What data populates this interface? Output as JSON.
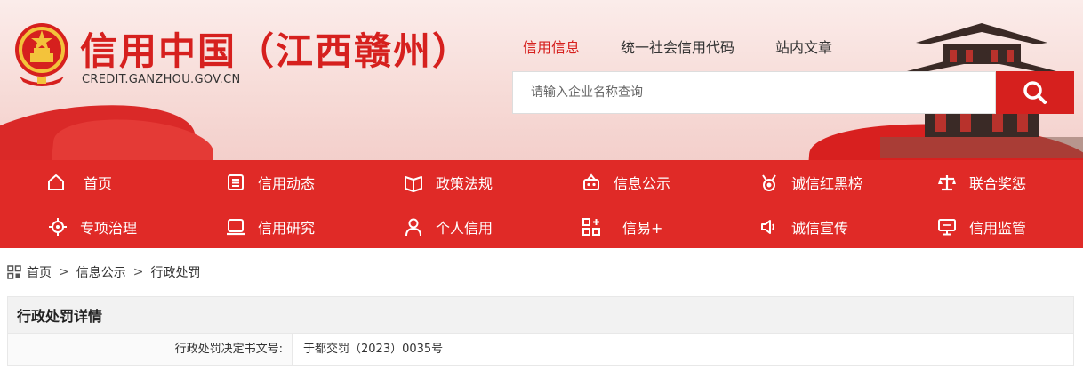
{
  "header": {
    "title": "信用中国（江西赣州）",
    "url": "CREDIT.GANZHOU.GOV.CN",
    "top_links": [
      {
        "label": "信用信息",
        "active": true
      },
      {
        "label": "统一社会信用代码",
        "active": false
      },
      {
        "label": "站内文章",
        "active": false
      }
    ],
    "search": {
      "placeholder": "请输入企业名称查询",
      "value": ""
    },
    "accent_color": "#d6201e"
  },
  "nav": {
    "items": [
      {
        "label": "首页",
        "icon": "home-icon"
      },
      {
        "label": "信用动态",
        "icon": "list-icon"
      },
      {
        "label": "政策法规",
        "icon": "book-icon"
      },
      {
        "label": "信息公示",
        "icon": "announce-icon"
      },
      {
        "label": "诚信红黑榜",
        "icon": "medal-icon"
      },
      {
        "label": "联合奖惩",
        "icon": "scale-icon"
      },
      {
        "label": "专项治理",
        "icon": "target-icon"
      },
      {
        "label": "信用研究",
        "icon": "laptop-icon"
      },
      {
        "label": "个人信用",
        "icon": "person-icon"
      },
      {
        "label": "信易+",
        "icon": "grid-plus-icon"
      },
      {
        "label": "诚信宣传",
        "icon": "speaker-icon"
      },
      {
        "label": "信用监管",
        "icon": "monitor-icon"
      }
    ],
    "bg_color": "#e02a27"
  },
  "breadcrumb": {
    "items": [
      "首页",
      "信息公示",
      "行政处罚"
    ],
    "separator": ">"
  },
  "detail": {
    "heading": "行政处罚详情",
    "rows": [
      {
        "key": "行政处罚决定书文号:",
        "value": "于都交罚（2023）0035号"
      }
    ]
  }
}
